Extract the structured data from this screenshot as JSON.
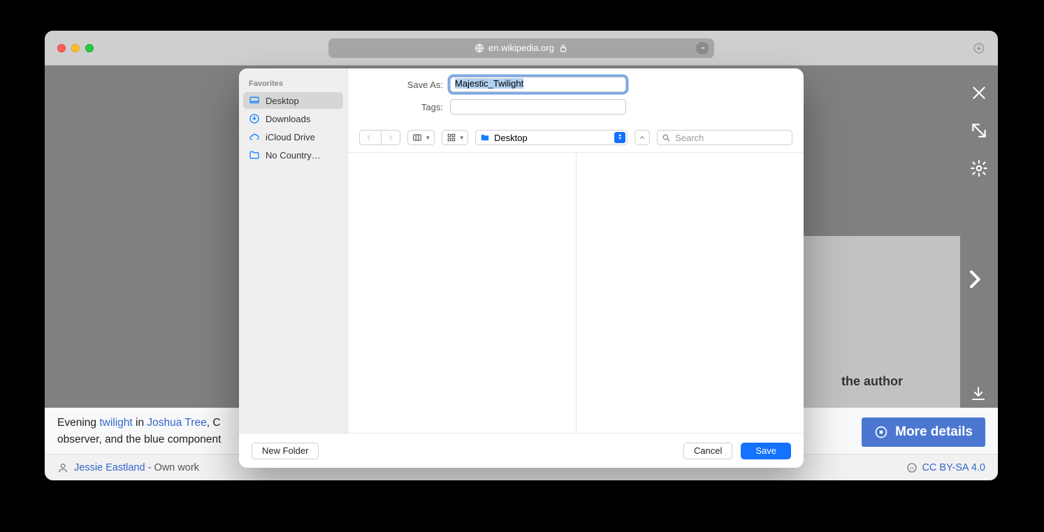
{
  "browser": {
    "url": "en.wikipedia.org"
  },
  "page": {
    "author_fragment": "the author",
    "caption": {
      "prefix": "Evening ",
      "link1": "twilight",
      "mid1": " in ",
      "link2": "Joshua Tree",
      "mid2": ", C",
      "line2_prefix": "observer, and the blue component"
    },
    "more_details": "More details",
    "footer": {
      "author": "Jessie Eastland",
      "ownwork": " - Own work",
      "license": "CC BY-SA 4.0"
    }
  },
  "dialog": {
    "labels": {
      "save_as": "Save As:",
      "tags": "Tags:"
    },
    "save_as_value": "Majestic_Twilight",
    "tags_value": "",
    "sidebar": {
      "header": "Favorites",
      "items": [
        {
          "label": "Desktop",
          "selected": true
        },
        {
          "label": "Downloads",
          "selected": false
        },
        {
          "label": "iCloud Drive",
          "selected": false
        },
        {
          "label": "No Country…",
          "selected": false
        }
      ]
    },
    "location": "Desktop",
    "search_placeholder": "Search",
    "buttons": {
      "new_folder": "New Folder",
      "cancel": "Cancel",
      "save": "Save"
    }
  }
}
